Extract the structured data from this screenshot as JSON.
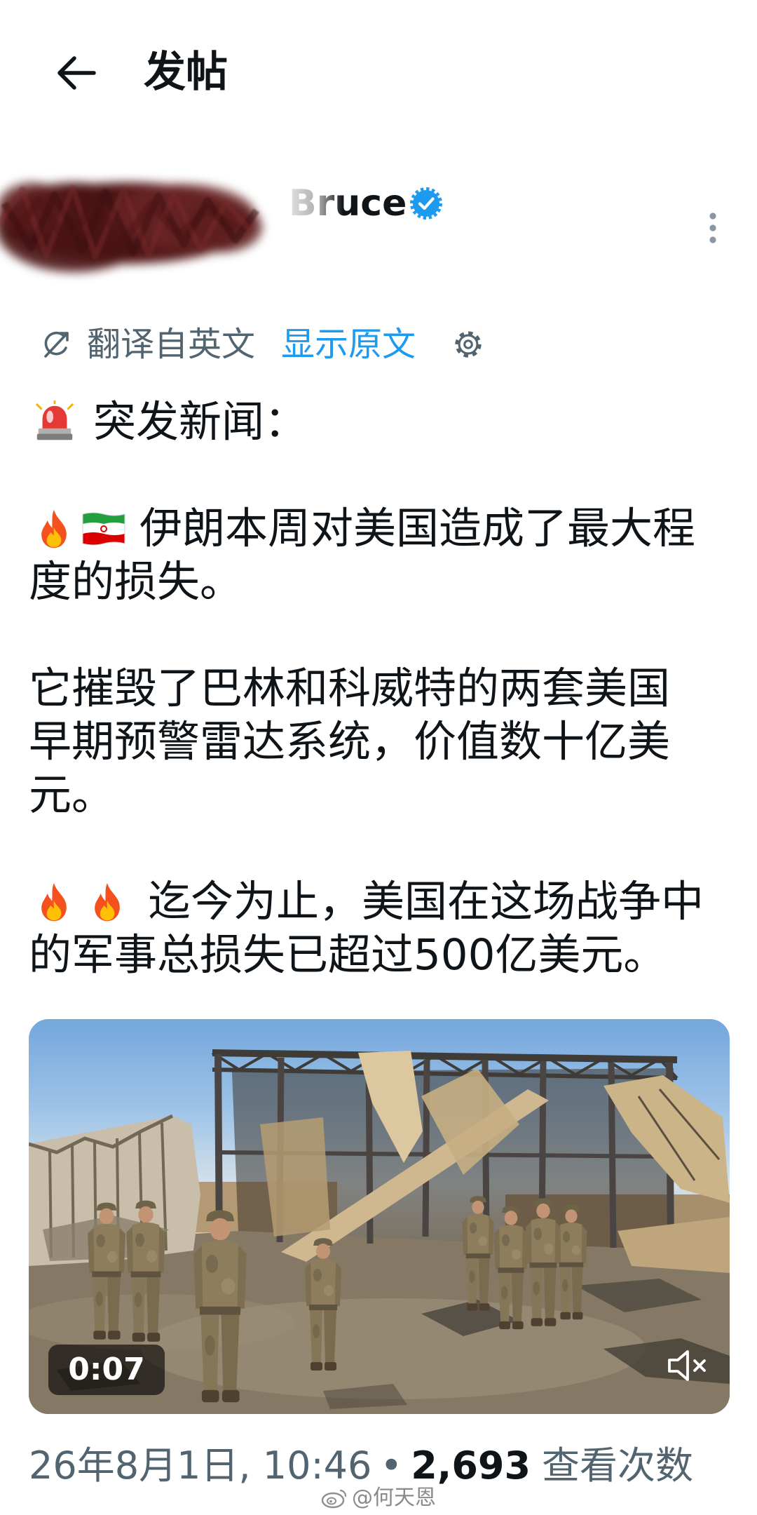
{
  "header": {
    "title": "发帖",
    "back_icon": "arrow-left-icon"
  },
  "author": {
    "name": "Bruce",
    "verified": true,
    "verified_icon": "verified-badge-icon",
    "avatar_redacted": true,
    "more_icon": "more-vertical-icon"
  },
  "translation": {
    "icon": "translate-icon",
    "label": "翻译自英文",
    "show_original": "显示原文",
    "settings_icon": "gear-icon"
  },
  "post": {
    "paragraphs": [
      {
        "emoji": [
          "siren-icon"
        ],
        "lines": [
          "突发新闻："
        ]
      },
      {
        "emoji": [
          "fire-icon",
          "iran-flag-icon"
        ],
        "lines": [
          "伊朗本周对美国造成了最大程",
          "度的损失。"
        ]
      },
      {
        "emoji": [],
        "lines": [
          "它摧毁了巴林和科威特的两套美国",
          "早期预警雷达系统，价值数十亿美",
          "元。"
        ]
      },
      {
        "emoji": [
          "fire-icon",
          "fire-icon"
        ],
        "lines": [
          "迄今为止，美国在这场战争中",
          "的军事总损失已超过500亿美元。"
        ]
      }
    ]
  },
  "media": {
    "duration": "0:07",
    "muted": true,
    "mute_icon": "volume-muted-icon"
  },
  "footer": {
    "timestamp": "26年8月1日, 10:46",
    "separator": "•",
    "views": "2,693",
    "views_label": "查看次数"
  },
  "watermark": {
    "logo_icon": "weibo-logo-icon",
    "text": "@何天恩"
  },
  "colors": {
    "text": "#0f1419",
    "secondary": "#536471",
    "link": "#1d9bf0",
    "verified": "#1d9bf0",
    "redaction": "#55191a",
    "background": "#ffffff"
  }
}
